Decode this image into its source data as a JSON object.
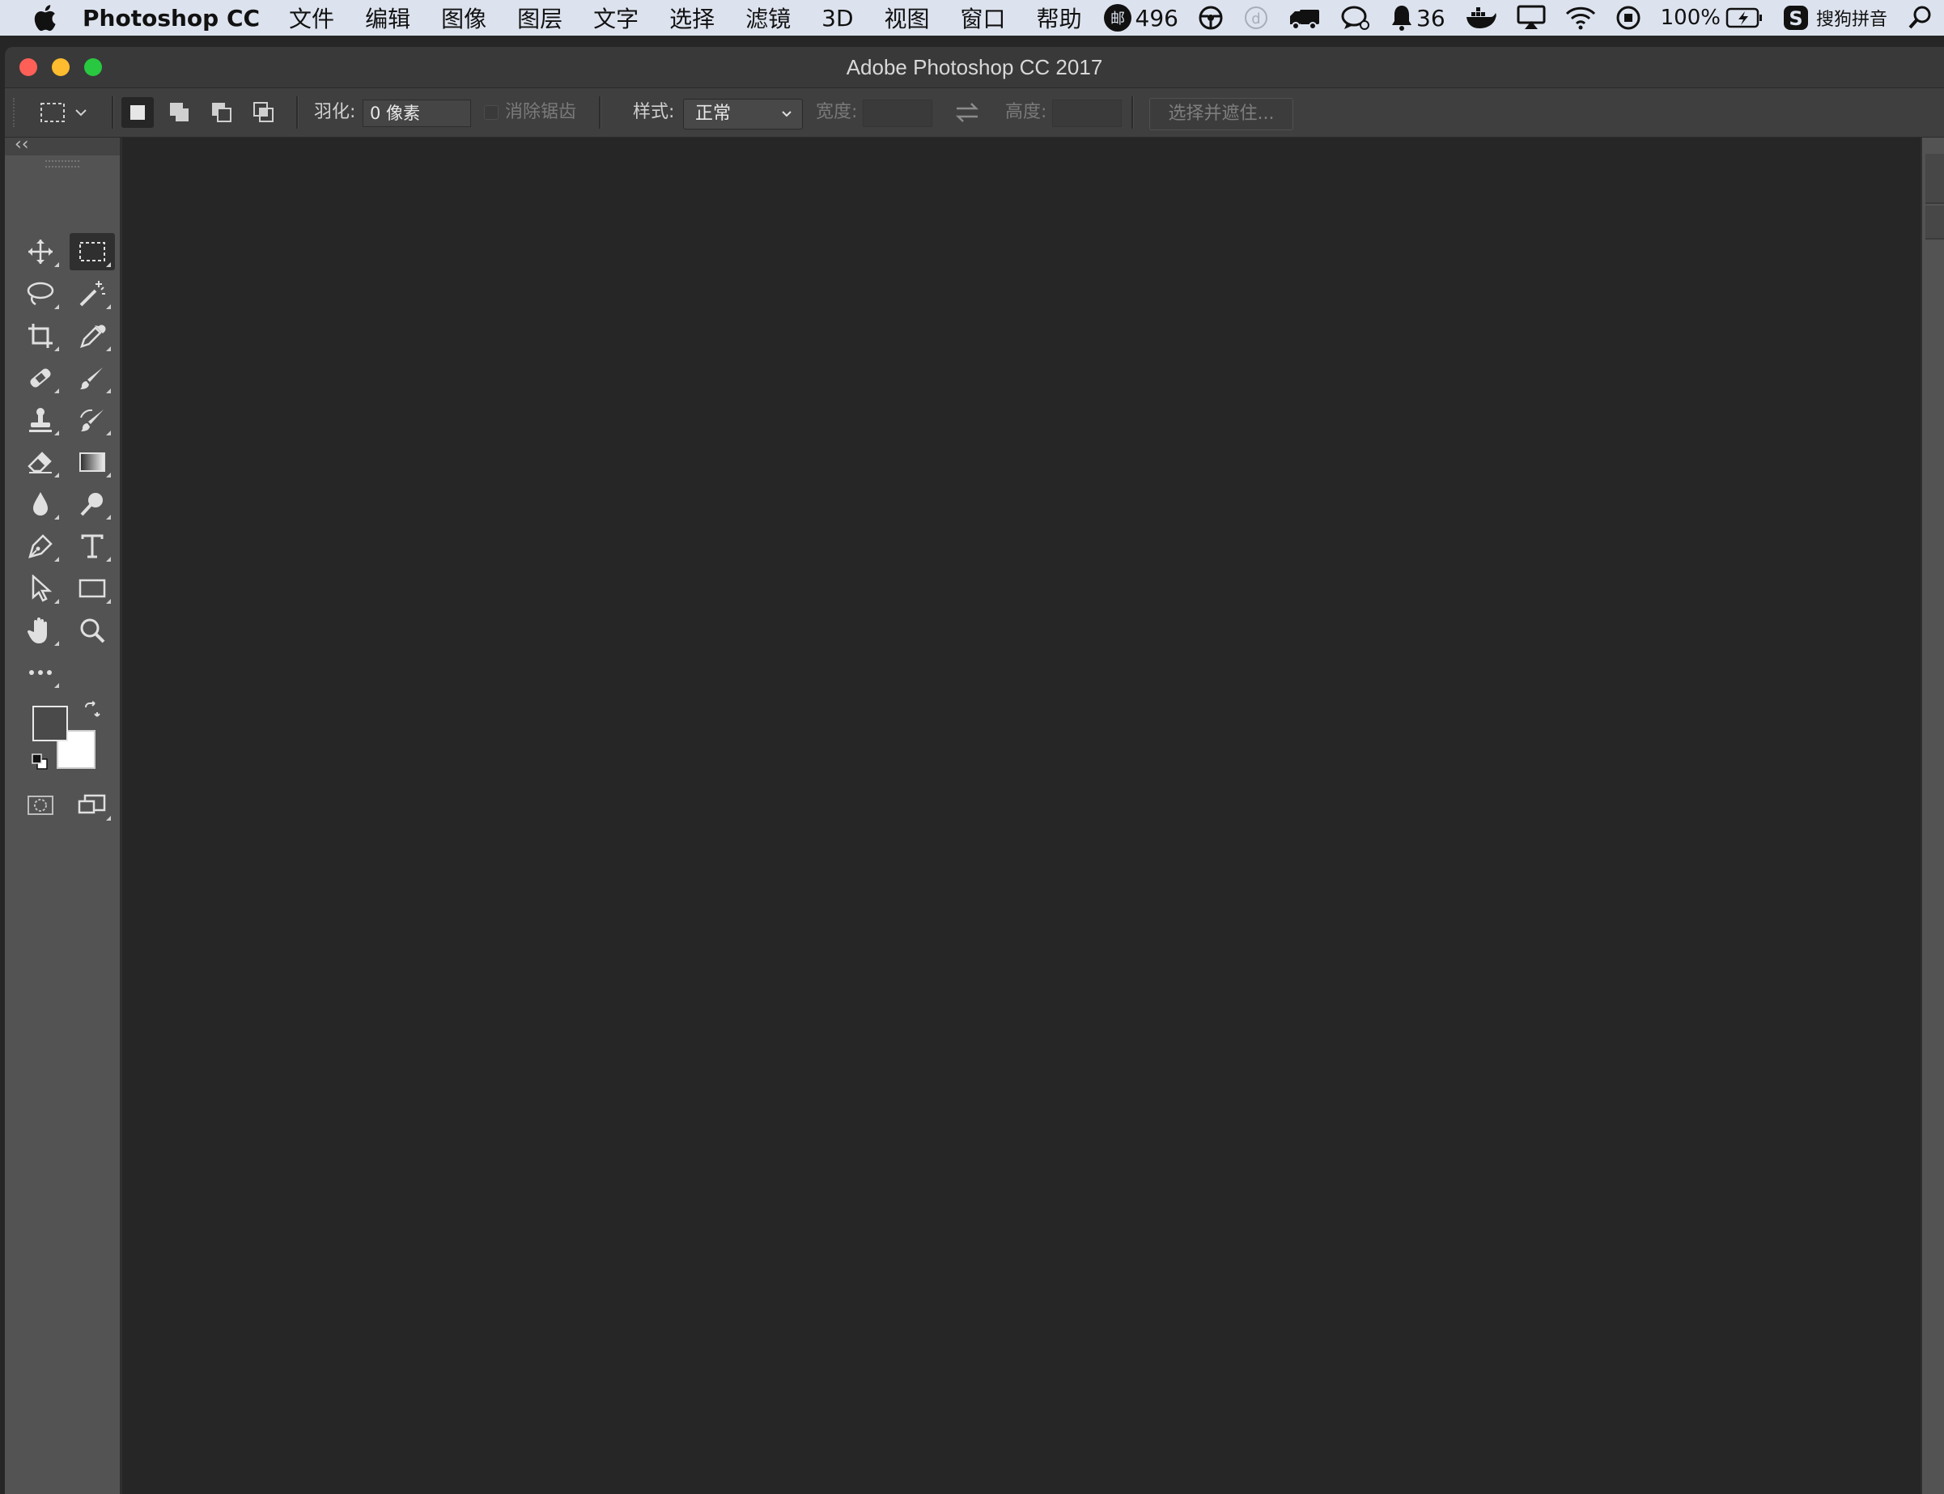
{
  "menubar": {
    "app_name": "Photoshop CC",
    "menus": [
      "文件",
      "编辑",
      "图像",
      "图层",
      "文字",
      "选择",
      "滤镜",
      "3D",
      "视图",
      "窗口",
      "帮助"
    ],
    "status": {
      "unread_count": "496",
      "qq_count": "36",
      "battery": "100%",
      "input_method": "搜狗拼音"
    }
  },
  "window": {
    "title": "Adobe Photoshop CC 2017"
  },
  "options": {
    "feather_label": "羽化:",
    "feather_value": "0 像素",
    "antialias_label": "消除锯齿",
    "style_label": "样式:",
    "style_value": "正常",
    "width_label": "宽度:",
    "height_label": "高度:",
    "select_mask_button": "选择并遮住..."
  },
  "tools": [
    {
      "name": "move-tool",
      "icon": "move-icon",
      "active": false
    },
    {
      "name": "rectangular-marquee-tool",
      "icon": "marquee-icon",
      "active": true
    },
    {
      "name": "lasso-tool",
      "icon": "lasso-icon",
      "active": false
    },
    {
      "name": "magic-wand-tool",
      "icon": "magic-wand-icon",
      "active": false
    },
    {
      "name": "crop-tool",
      "icon": "crop-icon",
      "active": false
    },
    {
      "name": "eyedropper-tool",
      "icon": "eyedropper-icon",
      "active": false
    },
    {
      "name": "healing-brush-tool",
      "icon": "bandage-icon",
      "active": false
    },
    {
      "name": "brush-tool",
      "icon": "brush-icon",
      "active": false
    },
    {
      "name": "clone-stamp-tool",
      "icon": "stamp-icon",
      "active": false
    },
    {
      "name": "history-brush-tool",
      "icon": "history-brush-icon",
      "active": false
    },
    {
      "name": "eraser-tool",
      "icon": "eraser-icon",
      "active": false
    },
    {
      "name": "gradient-tool",
      "icon": "gradient-icon",
      "active": false
    },
    {
      "name": "blur-tool",
      "icon": "drop-icon",
      "active": false
    },
    {
      "name": "dodge-tool",
      "icon": "dodge-icon",
      "active": false
    },
    {
      "name": "pen-tool",
      "icon": "pen-icon",
      "active": false
    },
    {
      "name": "type-tool",
      "icon": "type-icon",
      "active": false
    },
    {
      "name": "path-selection-tool",
      "icon": "arrow-icon",
      "active": false
    },
    {
      "name": "rectangle-tool",
      "icon": "rectangle-icon",
      "active": false
    },
    {
      "name": "hand-tool",
      "icon": "hand-icon",
      "active": false
    },
    {
      "name": "zoom-tool",
      "icon": "magnifier-icon",
      "active": false
    },
    {
      "name": "edit-toolbar",
      "icon": "more-icon",
      "active": false
    }
  ],
  "colors": {
    "foreground": "#4a4a4a",
    "background": "#ffffff",
    "accent_close": "#fe5f57",
    "accent_minimize": "#febc2e",
    "accent_maximize": "#28c840"
  }
}
